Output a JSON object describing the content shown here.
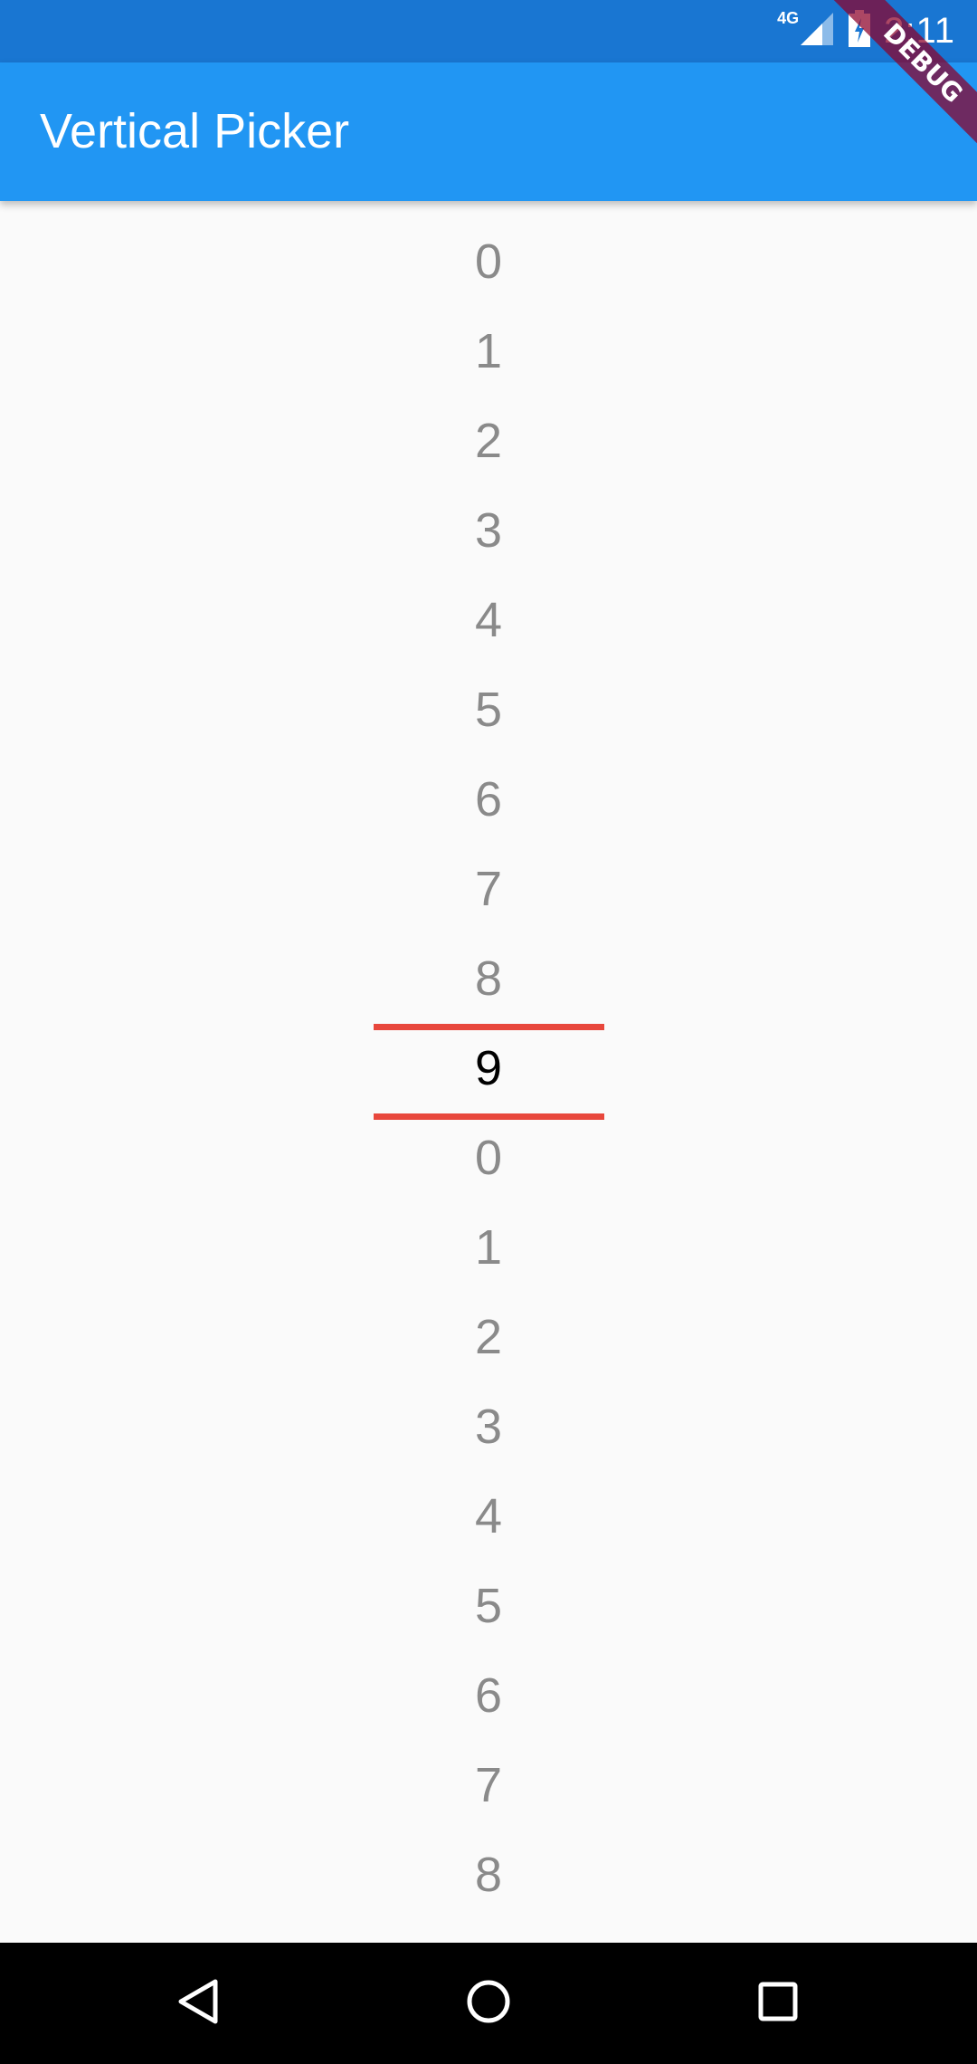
{
  "status_bar": {
    "network_label": "4G",
    "time": "2:11",
    "icons": [
      "signal-icon",
      "battery-charging-icon"
    ]
  },
  "debug_banner": "DEBUG",
  "app_bar": {
    "title": "Vertical Picker"
  },
  "picker": {
    "items": [
      "0",
      "1",
      "2",
      "3",
      "4",
      "5",
      "6",
      "7",
      "8",
      "9",
      "0",
      "1",
      "2",
      "3",
      "4",
      "5",
      "6",
      "7",
      "8"
    ],
    "selected_value": "9",
    "colors": {
      "selected_text": "#000000",
      "unselected_text": "#8a8a8a",
      "indicator": "#e8473c"
    }
  },
  "nav_bar": {
    "buttons": [
      "back-icon",
      "home-icon",
      "recents-icon"
    ]
  },
  "colors": {
    "status_bar": "#1976d2",
    "app_bar": "#2196f3",
    "background": "#fafafa"
  }
}
